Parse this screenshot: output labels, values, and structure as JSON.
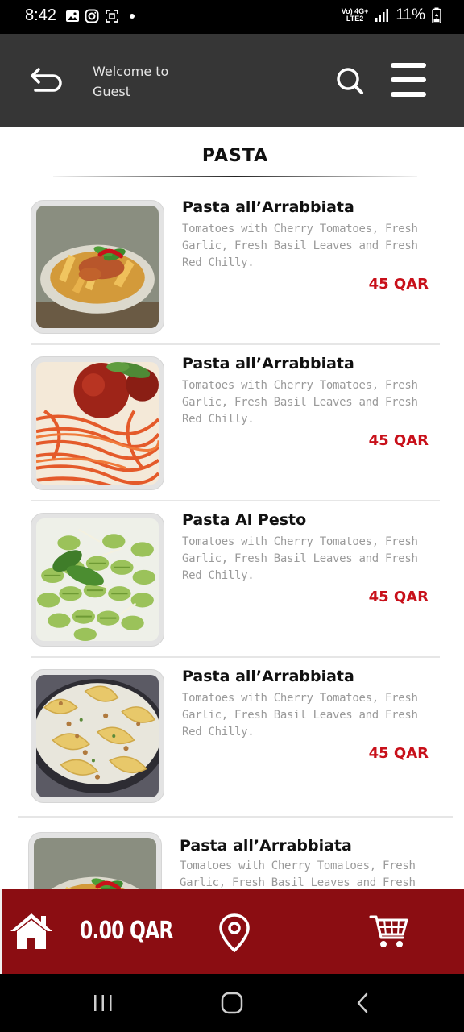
{
  "status_bar": {
    "time": "8:42",
    "network_top": "Vo) 4G+",
    "network_bottom": "LTE2",
    "battery": "11%"
  },
  "header": {
    "welcome_line1": "Welcome to",
    "welcome_line2": "Guest"
  },
  "section": {
    "title": "PASTA"
  },
  "menu_items": [
    {
      "name": "Pasta all’Arrabbiata",
      "description": "Tomatoes with Cherry Tomatoes, Fresh Garlic, Fresh Basil Leaves and Fresh Red Chilly.",
      "price": "45 QAR",
      "image": "penne-arrabbiata"
    },
    {
      "name": "Pasta all’Arrabbiata",
      "description": "Tomatoes with Cherry Tomatoes, Fresh Garlic, Fresh Basil Leaves and Fresh Red Chilly.",
      "price": "45 QAR",
      "image": "spaghetti-meatball"
    },
    {
      "name": "Pasta Al Pesto",
      "description": "Tomatoes with Cherry Tomatoes, Fresh Garlic, Fresh Basil Leaves and Fresh Red Chilly.",
      "price": "45 QAR",
      "image": "fusilli-pesto"
    },
    {
      "name": "Pasta all’Arrabbiata",
      "description": "Tomatoes with Cherry Tomatoes, Fresh Garlic, Fresh Basil Leaves and Fresh Red Chilly.",
      "price": "45 QAR",
      "image": "tagliatelle-cream"
    },
    {
      "name": "Pasta all’Arrabbiata",
      "description": "Tomatoes with Cherry Tomatoes, Fresh Garlic, Fresh Basil Leaves and Fresh Red",
      "price": "",
      "image": "penne-arrabbiata"
    }
  ],
  "bottom_bar": {
    "cart_total": "0.00 QAR",
    "icons": [
      "home-icon",
      "location-pin-icon",
      "cart-icon"
    ]
  },
  "colors": {
    "header_bg": "#363636",
    "accent_red": "#8b0d12",
    "price_red": "#c8101a"
  }
}
